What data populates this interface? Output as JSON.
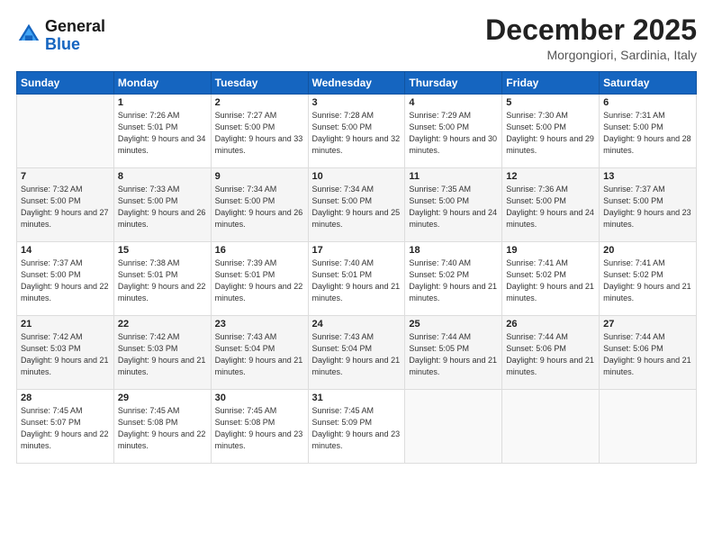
{
  "header": {
    "logo_general": "General",
    "logo_blue": "Blue",
    "month": "December 2025",
    "location": "Morgongiori, Sardinia, Italy"
  },
  "days_of_week": [
    "Sunday",
    "Monday",
    "Tuesday",
    "Wednesday",
    "Thursday",
    "Friday",
    "Saturday"
  ],
  "weeks": [
    [
      {
        "num": "",
        "sunrise": "",
        "sunset": "",
        "daylight": ""
      },
      {
        "num": "1",
        "sunrise": "Sunrise: 7:26 AM",
        "sunset": "Sunset: 5:01 PM",
        "daylight": "Daylight: 9 hours and 34 minutes."
      },
      {
        "num": "2",
        "sunrise": "Sunrise: 7:27 AM",
        "sunset": "Sunset: 5:00 PM",
        "daylight": "Daylight: 9 hours and 33 minutes."
      },
      {
        "num": "3",
        "sunrise": "Sunrise: 7:28 AM",
        "sunset": "Sunset: 5:00 PM",
        "daylight": "Daylight: 9 hours and 32 minutes."
      },
      {
        "num": "4",
        "sunrise": "Sunrise: 7:29 AM",
        "sunset": "Sunset: 5:00 PM",
        "daylight": "Daylight: 9 hours and 30 minutes."
      },
      {
        "num": "5",
        "sunrise": "Sunrise: 7:30 AM",
        "sunset": "Sunset: 5:00 PM",
        "daylight": "Daylight: 9 hours and 29 minutes."
      },
      {
        "num": "6",
        "sunrise": "Sunrise: 7:31 AM",
        "sunset": "Sunset: 5:00 PM",
        "daylight": "Daylight: 9 hours and 28 minutes."
      }
    ],
    [
      {
        "num": "7",
        "sunrise": "Sunrise: 7:32 AM",
        "sunset": "Sunset: 5:00 PM",
        "daylight": "Daylight: 9 hours and 27 minutes."
      },
      {
        "num": "8",
        "sunrise": "Sunrise: 7:33 AM",
        "sunset": "Sunset: 5:00 PM",
        "daylight": "Daylight: 9 hours and 26 minutes."
      },
      {
        "num": "9",
        "sunrise": "Sunrise: 7:34 AM",
        "sunset": "Sunset: 5:00 PM",
        "daylight": "Daylight: 9 hours and 26 minutes."
      },
      {
        "num": "10",
        "sunrise": "Sunrise: 7:34 AM",
        "sunset": "Sunset: 5:00 PM",
        "daylight": "Daylight: 9 hours and 25 minutes."
      },
      {
        "num": "11",
        "sunrise": "Sunrise: 7:35 AM",
        "sunset": "Sunset: 5:00 PM",
        "daylight": "Daylight: 9 hours and 24 minutes."
      },
      {
        "num": "12",
        "sunrise": "Sunrise: 7:36 AM",
        "sunset": "Sunset: 5:00 PM",
        "daylight": "Daylight: 9 hours and 24 minutes."
      },
      {
        "num": "13",
        "sunrise": "Sunrise: 7:37 AM",
        "sunset": "Sunset: 5:00 PM",
        "daylight": "Daylight: 9 hours and 23 minutes."
      }
    ],
    [
      {
        "num": "14",
        "sunrise": "Sunrise: 7:37 AM",
        "sunset": "Sunset: 5:00 PM",
        "daylight": "Daylight: 9 hours and 22 minutes."
      },
      {
        "num": "15",
        "sunrise": "Sunrise: 7:38 AM",
        "sunset": "Sunset: 5:01 PM",
        "daylight": "Daylight: 9 hours and 22 minutes."
      },
      {
        "num": "16",
        "sunrise": "Sunrise: 7:39 AM",
        "sunset": "Sunset: 5:01 PM",
        "daylight": "Daylight: 9 hours and 22 minutes."
      },
      {
        "num": "17",
        "sunrise": "Sunrise: 7:40 AM",
        "sunset": "Sunset: 5:01 PM",
        "daylight": "Daylight: 9 hours and 21 minutes."
      },
      {
        "num": "18",
        "sunrise": "Sunrise: 7:40 AM",
        "sunset": "Sunset: 5:02 PM",
        "daylight": "Daylight: 9 hours and 21 minutes."
      },
      {
        "num": "19",
        "sunrise": "Sunrise: 7:41 AM",
        "sunset": "Sunset: 5:02 PM",
        "daylight": "Daylight: 9 hours and 21 minutes."
      },
      {
        "num": "20",
        "sunrise": "Sunrise: 7:41 AM",
        "sunset": "Sunset: 5:02 PM",
        "daylight": "Daylight: 9 hours and 21 minutes."
      }
    ],
    [
      {
        "num": "21",
        "sunrise": "Sunrise: 7:42 AM",
        "sunset": "Sunset: 5:03 PM",
        "daylight": "Daylight: 9 hours and 21 minutes."
      },
      {
        "num": "22",
        "sunrise": "Sunrise: 7:42 AM",
        "sunset": "Sunset: 5:03 PM",
        "daylight": "Daylight: 9 hours and 21 minutes."
      },
      {
        "num": "23",
        "sunrise": "Sunrise: 7:43 AM",
        "sunset": "Sunset: 5:04 PM",
        "daylight": "Daylight: 9 hours and 21 minutes."
      },
      {
        "num": "24",
        "sunrise": "Sunrise: 7:43 AM",
        "sunset": "Sunset: 5:04 PM",
        "daylight": "Daylight: 9 hours and 21 minutes."
      },
      {
        "num": "25",
        "sunrise": "Sunrise: 7:44 AM",
        "sunset": "Sunset: 5:05 PM",
        "daylight": "Daylight: 9 hours and 21 minutes."
      },
      {
        "num": "26",
        "sunrise": "Sunrise: 7:44 AM",
        "sunset": "Sunset: 5:06 PM",
        "daylight": "Daylight: 9 hours and 21 minutes."
      },
      {
        "num": "27",
        "sunrise": "Sunrise: 7:44 AM",
        "sunset": "Sunset: 5:06 PM",
        "daylight": "Daylight: 9 hours and 21 minutes."
      }
    ],
    [
      {
        "num": "28",
        "sunrise": "Sunrise: 7:45 AM",
        "sunset": "Sunset: 5:07 PM",
        "daylight": "Daylight: 9 hours and 22 minutes."
      },
      {
        "num": "29",
        "sunrise": "Sunrise: 7:45 AM",
        "sunset": "Sunset: 5:08 PM",
        "daylight": "Daylight: 9 hours and 22 minutes."
      },
      {
        "num": "30",
        "sunrise": "Sunrise: 7:45 AM",
        "sunset": "Sunset: 5:08 PM",
        "daylight": "Daylight: 9 hours and 23 minutes."
      },
      {
        "num": "31",
        "sunrise": "Sunrise: 7:45 AM",
        "sunset": "Sunset: 5:09 PM",
        "daylight": "Daylight: 9 hours and 23 minutes."
      },
      {
        "num": "",
        "sunrise": "",
        "sunset": "",
        "daylight": ""
      },
      {
        "num": "",
        "sunrise": "",
        "sunset": "",
        "daylight": ""
      },
      {
        "num": "",
        "sunrise": "",
        "sunset": "",
        "daylight": ""
      }
    ]
  ]
}
